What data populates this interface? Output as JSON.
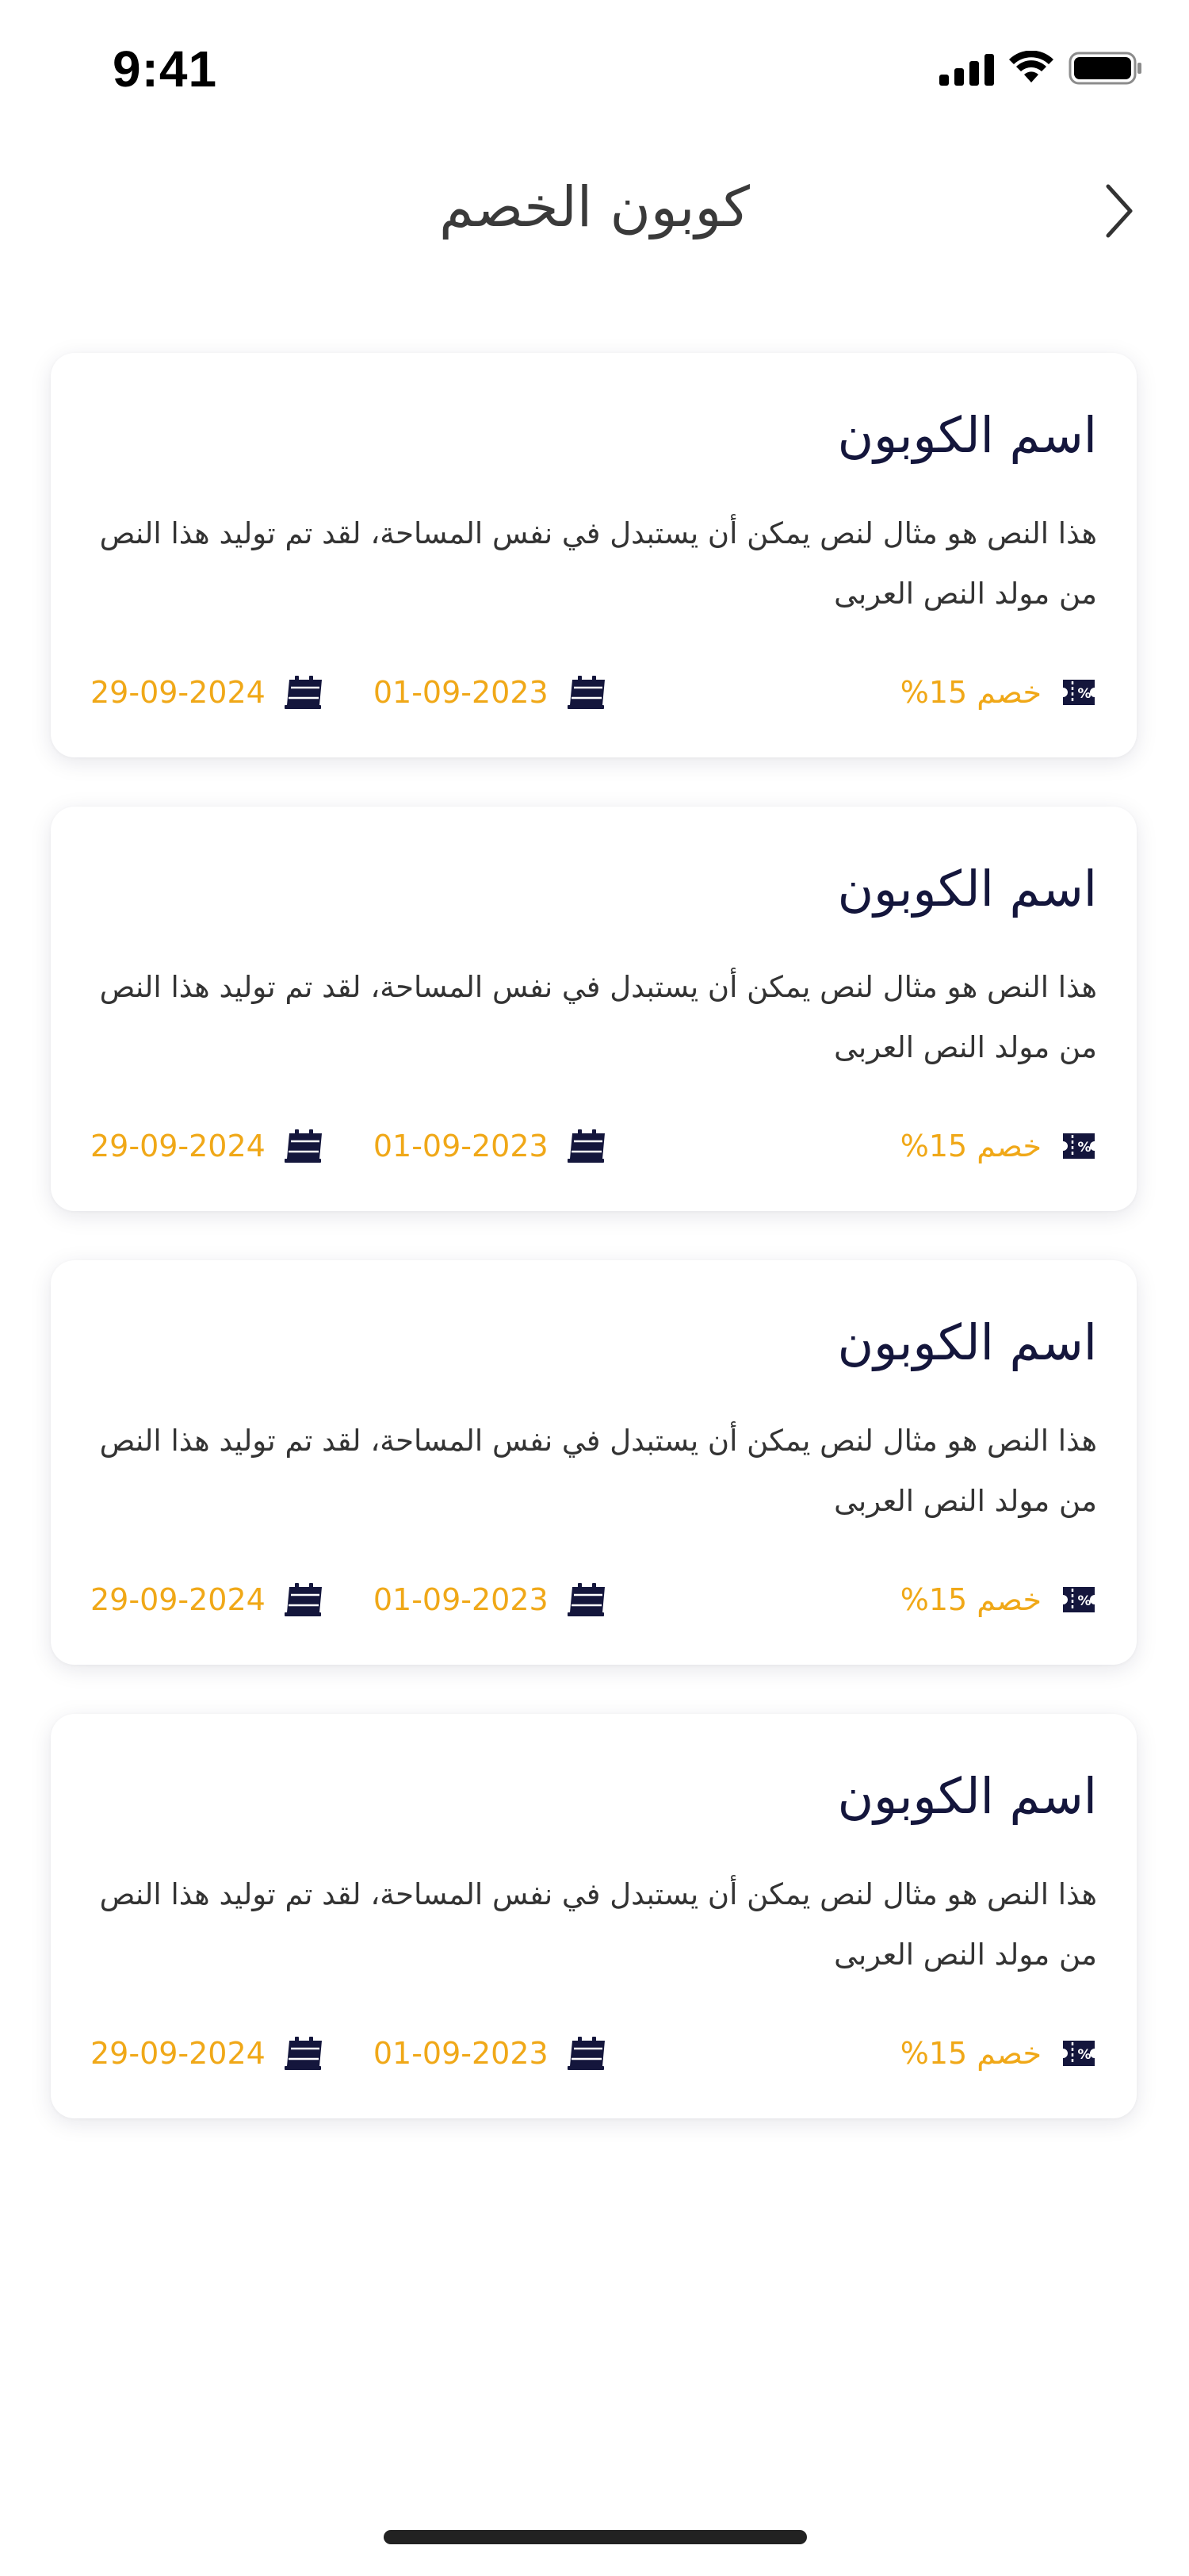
{
  "status_bar": {
    "time": "9:41"
  },
  "header": {
    "title": "كوبون الخصم"
  },
  "colors": {
    "accent": "#f0a818",
    "navy": "#14163c"
  },
  "coupons": [
    {
      "name": "اسم الكوبون",
      "description": "هذا النص هو مثال لنص يمكن أن يستبدل في نفس المساحة، لقد تم توليد هذا النص من مولد النص العربى",
      "discount": "خصم 15%",
      "start_date": "01-09-2023",
      "end_date": "29-09-2024"
    },
    {
      "name": "اسم الكوبون",
      "description": "هذا النص هو مثال لنص يمكن أن يستبدل في نفس المساحة، لقد تم توليد هذا النص من مولد النص العربى",
      "discount": "خصم 15%",
      "start_date": "01-09-2023",
      "end_date": "29-09-2024"
    },
    {
      "name": "اسم الكوبون",
      "description": "هذا النص هو مثال لنص يمكن أن يستبدل في نفس المساحة، لقد تم توليد هذا النص من مولد النص العربى",
      "discount": "خصم 15%",
      "start_date": "01-09-2023",
      "end_date": "29-09-2024"
    },
    {
      "name": "اسم الكوبون",
      "description": "هذا النص هو مثال لنص يمكن أن يستبدل في نفس المساحة، لقد تم توليد هذا النص من مولد النص العربى",
      "discount": "خصم 15%",
      "start_date": "01-09-2023",
      "end_date": "29-09-2024"
    }
  ],
  "icons": {
    "back": "chevron-right-icon",
    "discount": "ticket-percent-icon",
    "date": "calendar-icon"
  }
}
